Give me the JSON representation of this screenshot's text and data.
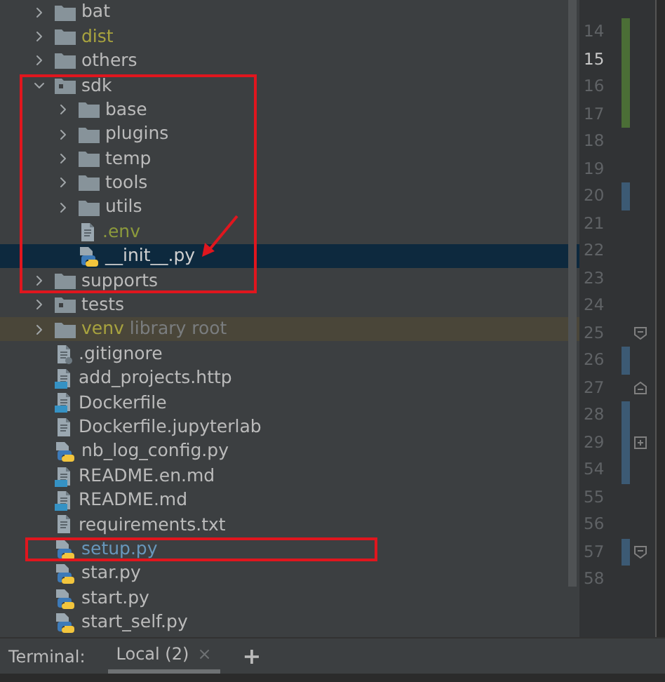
{
  "project_tree": {
    "items": [
      {
        "kind": "folder",
        "name": "bat",
        "color": "#bbbbbb",
        "expanded": false,
        "selected": false
      },
      {
        "kind": "folder",
        "name": "dist",
        "color": "#a8a33f",
        "expanded": false,
        "selected": false
      },
      {
        "kind": "folder",
        "name": "others",
        "color": "#bbbbbb",
        "expanded": false,
        "selected": false
      },
      {
        "kind": "module",
        "name": "sdk",
        "color": "#bbbbbb",
        "expanded": true,
        "selected": false,
        "children": [
          {
            "kind": "folder",
            "name": "base",
            "color": "#bbbbbb",
            "expanded": false,
            "selected": false
          },
          {
            "kind": "folder",
            "name": "plugins",
            "color": "#bbbbbb",
            "expanded": false,
            "selected": false
          },
          {
            "kind": "folder",
            "name": "temp",
            "color": "#bbbbbb",
            "expanded": false,
            "selected": false
          },
          {
            "kind": "folder",
            "name": "tools",
            "color": "#bbbbbb",
            "expanded": false,
            "selected": false
          },
          {
            "kind": "folder",
            "name": "utils",
            "color": "#bbbbbb",
            "expanded": false,
            "selected": false
          },
          {
            "kind": "env",
            "name": ".env",
            "color": "#8c9a3c",
            "selected": false
          },
          {
            "kind": "python",
            "name": "__init__.py",
            "selected": true
          }
        ]
      },
      {
        "kind": "folder",
        "name": "supports",
        "color": "#bbbbbb",
        "expanded": false,
        "selected": false
      },
      {
        "kind": "module",
        "name": "tests",
        "color": "#bbbbbb",
        "expanded": false,
        "selected": false
      },
      {
        "kind": "folder",
        "name": "venv",
        "note": "library root",
        "color": "#a8a33f",
        "expanded": false,
        "selected": false,
        "highlighted": true
      },
      {
        "kind": "gitignore",
        "name": ".gitignore",
        "color": "#bbbbbb",
        "selected": false
      },
      {
        "kind": "http",
        "name": "add_projects.http",
        "color": "#bbbbbb",
        "selected": false
      },
      {
        "kind": "docker",
        "name": "Dockerfile",
        "color": "#bbbbbb",
        "selected": false
      },
      {
        "kind": "text",
        "name": "Dockerfile.jupyterlab",
        "color": "#bbbbbb",
        "selected": false
      },
      {
        "kind": "python",
        "name": "nb_log_config.py",
        "color": "#bbbbbb",
        "selected": false
      },
      {
        "kind": "markdown",
        "name": "README.en.md",
        "color": "#bbbbbb",
        "selected": false
      },
      {
        "kind": "markdown",
        "name": "README.md",
        "color": "#bbbbbb",
        "selected": false
      },
      {
        "kind": "text",
        "name": "requirements.txt",
        "color": "#bbbbbb",
        "selected": false
      },
      {
        "kind": "python",
        "name": "setup.py",
        "color": "#6897bb",
        "selected": false,
        "boxed": true
      },
      {
        "kind": "python",
        "name": "star.py",
        "color": "#bbbbbb",
        "selected": false
      },
      {
        "kind": "python",
        "name": "start.py",
        "color": "#bbbbbb",
        "selected": false
      },
      {
        "kind": "python",
        "name": "start_self.py",
        "color": "#bbbbbb",
        "selected": false
      }
    ]
  },
  "gutter": {
    "lines": [
      {
        "number": "14",
        "current": false,
        "kind": "plain",
        "color": "#4b6e36"
      },
      {
        "number": "15",
        "current": true,
        "kind": "plain",
        "color": "#4b6e36"
      },
      {
        "number": "16",
        "current": false,
        "kind": "plain",
        "color": "#4b6e36"
      },
      {
        "number": "17",
        "current": false,
        "kind": "plain",
        "color": "#4b6e36"
      },
      {
        "number": "18",
        "current": false,
        "kind": "plain"
      },
      {
        "number": "19",
        "current": false,
        "kind": "plain"
      },
      {
        "number": "20",
        "current": false,
        "kind": "plain",
        "color": "#3c5a74"
      },
      {
        "number": "21",
        "current": false,
        "kind": "plain"
      },
      {
        "number": "22",
        "current": false,
        "kind": "plain"
      },
      {
        "number": "23",
        "current": false,
        "kind": "plain"
      },
      {
        "number": "24",
        "current": false,
        "kind": "plain"
      },
      {
        "number": "25",
        "current": false,
        "kind": "fold_start"
      },
      {
        "number": "26",
        "current": false,
        "kind": "plain",
        "color": "#3c5a74"
      },
      {
        "number": "27",
        "current": false,
        "kind": "fold_end"
      },
      {
        "number": "28",
        "current": false,
        "kind": "plain",
        "color": "#3c5a74"
      },
      {
        "number": "29",
        "current": false,
        "kind": "fold_collapsed",
        "color": "#3c5a74"
      },
      {
        "number": "54",
        "current": false,
        "kind": "plain",
        "color": "#3c5a74"
      },
      {
        "number": "55",
        "current": false,
        "kind": "plain"
      },
      {
        "number": "56",
        "current": false,
        "kind": "plain"
      },
      {
        "number": "57",
        "current": false,
        "kind": "fold_start",
        "color": "#3c5a74"
      },
      {
        "number": "58",
        "current": false,
        "kind": "plain"
      }
    ]
  },
  "terminal_bar": {
    "label": "Terminal:",
    "tabs": [
      {
        "label": "Local (2)",
        "close": "×",
        "selected": true
      }
    ],
    "add": "+"
  }
}
